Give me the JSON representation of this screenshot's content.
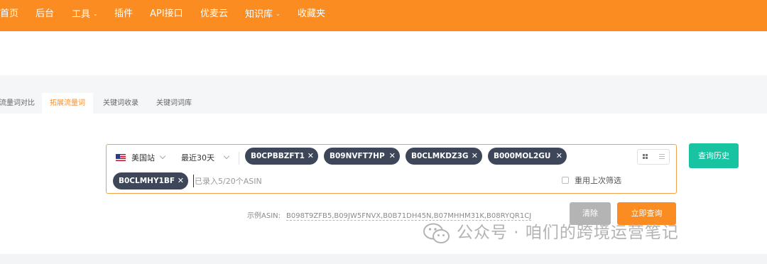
{
  "nav": {
    "items": [
      {
        "label": "首页",
        "dropdown": false
      },
      {
        "label": "后台",
        "dropdown": false
      },
      {
        "label": "工具",
        "dropdown": true
      },
      {
        "label": "插件",
        "dropdown": false
      },
      {
        "label": "API接口",
        "dropdown": false
      },
      {
        "label": "优麦云",
        "dropdown": false
      },
      {
        "label": "知识库",
        "dropdown": true
      },
      {
        "label": "收藏夹",
        "dropdown": false
      }
    ]
  },
  "tabs": [
    {
      "label": "流量词对比",
      "active": false
    },
    {
      "label": "拓展流量词",
      "active": true
    },
    {
      "label": "关键词收录",
      "active": false
    },
    {
      "label": "关键词词库",
      "active": false
    }
  ],
  "search": {
    "site": "美国站",
    "site_flag_icon": "us-flag-icon",
    "range": "最近30天",
    "tags": [
      "B0CPBBZFT1",
      "B09NVFT7HP",
      "B0CLMKDZ3G",
      "B000MOL2GU",
      "B0CLMHY1BF"
    ],
    "placeholder": "已录入5/20个ASIN",
    "reuse_label": "重用上次筛选",
    "reuse_checked": false,
    "view_icons": [
      "grid-view-icon",
      "list-view-icon"
    ]
  },
  "buttons": {
    "history": "查询历史",
    "clear": "清除",
    "query": "立即查询"
  },
  "example": {
    "label": "示例ASIN:",
    "value": "B098T9ZFB5,B09JW5FNVX,B0B71DH45N,B07MHHM31K,B08RYQR1CJ"
  },
  "watermark": {
    "text": "公众号 · 咱们的跨境运营笔记",
    "icon": "wechat-icon"
  },
  "colors": {
    "brand_orange": "#fa8c22",
    "teal": "#17c3a0",
    "tag_dark": "#3d4759",
    "clear_gray": "#b4b4b4"
  }
}
